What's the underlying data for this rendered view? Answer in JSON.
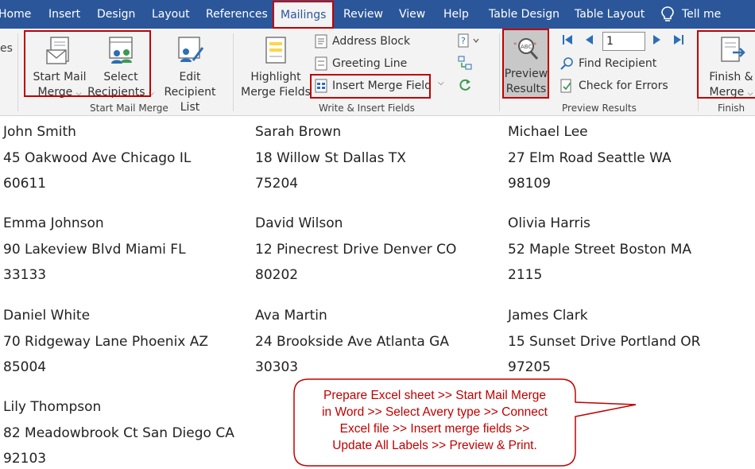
{
  "tabs": [
    {
      "label": "Home",
      "active": false
    },
    {
      "label": "Insert",
      "active": false
    },
    {
      "label": "Design",
      "active": false
    },
    {
      "label": "Layout",
      "active": false
    },
    {
      "label": "References",
      "active": false
    },
    {
      "label": "Mailings",
      "active": true
    },
    {
      "label": "Review",
      "active": false
    },
    {
      "label": "View",
      "active": false
    },
    {
      "label": "Help",
      "active": false
    },
    {
      "label": "Table Design",
      "active": false
    },
    {
      "label": "Table Layout",
      "active": false
    }
  ],
  "tell_me": "Tell me",
  "ribbon": {
    "left_cut": "es",
    "start_mail_merge": {
      "line1": "Start Mail",
      "line2": "Merge",
      "icon": "envelope-document-icon"
    },
    "select_recipients": {
      "line1": "Select",
      "line2": "Recipients",
      "icon": "people-list-icon"
    },
    "edit_recipient_list": {
      "line1": "Edit",
      "line2": "Recipient List",
      "icon": "people-edit-icon"
    },
    "group_start": "Start Mail Merge",
    "highlight_merge_fields": {
      "line1": "Highlight",
      "line2": "Merge Fields",
      "icon": "highlight-fields-icon"
    },
    "address_block": "Address Block",
    "greeting_line": "Greeting Line",
    "insert_merge_field": "Insert Merge Field",
    "group_write": "Write & Insert Fields",
    "preview_results": {
      "line1": "Preview",
      "line2": "Results",
      "icon": "abc-magnifier-icon"
    },
    "record_number": "1",
    "find_recipient": "Find Recipient",
    "check_for_errors": "Check for Errors",
    "group_preview": "Preview Results",
    "finish_merge": {
      "line1": "Finish &",
      "line2": "Merge",
      "icon": "finish-merge-icon"
    },
    "group_finish": "Finish"
  },
  "labels": [
    {
      "name": "John Smith",
      "street": "45 Oakwood Ave Chicago IL",
      "zip": "60611"
    },
    {
      "name": "Sarah Brown",
      "street": "18 Willow St Dallas TX",
      "zip": "75204"
    },
    {
      "name": "Michael Lee",
      "street": "27 Elm Road Seattle WA",
      "zip": "98109"
    },
    {
      "name": "Emma Johnson",
      "street": "90 Lakeview Blvd Miami FL",
      "zip": "33133"
    },
    {
      "name": "David Wilson",
      "street": "12 Pinecrest Drive Denver CO",
      "zip": "80202"
    },
    {
      "name": "Olivia Harris",
      "street": "52 Maple Street Boston MA",
      "zip": "2115"
    },
    {
      "name": "Daniel White",
      "street": "70 Ridgeway Lane Phoenix AZ",
      "zip": "85004"
    },
    {
      "name": "Ava Martin",
      "street": "24 Brookside Ave Atlanta GA",
      "zip": "30303"
    },
    {
      "name": "James Clark",
      "street": "15 Sunset Drive Portland OR",
      "zip": "97205"
    },
    {
      "name": "Lily Thompson",
      "street": "82 Meadowbrook Ct San Diego CA",
      "zip": "92103"
    }
  ],
  "callout": {
    "lines": [
      "Prepare Excel sheet >> Start Mail Merge",
      "in Word >> Select Avery type >> Connect",
      "Excel file >> Insert merge fields >>",
      "Update All Labels >> Preview & Print."
    ],
    "color": "#c00000"
  },
  "colors": {
    "tabbar": "#2b579a",
    "highlight": "#c00000",
    "ribbon": "#f3f3f3"
  }
}
